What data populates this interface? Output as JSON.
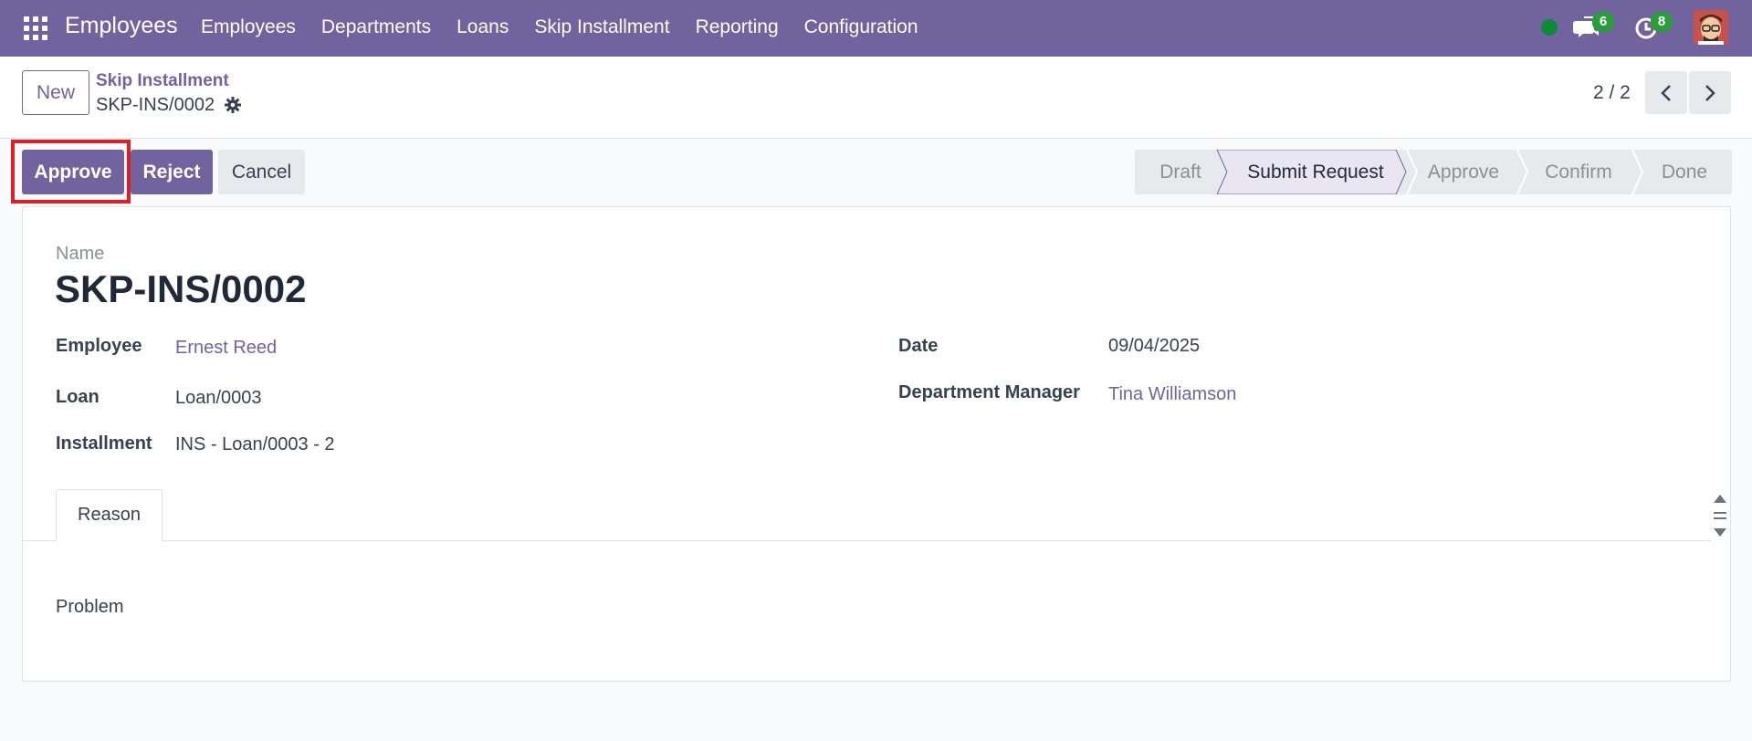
{
  "navbar": {
    "app_title": "Employees",
    "menu": [
      "Employees",
      "Departments",
      "Loans",
      "Skip Installment",
      "Reporting",
      "Configuration"
    ],
    "messages_count": "6",
    "activities_count": "8",
    "background_color": "#71639e"
  },
  "control_panel": {
    "new_label": "New",
    "breadcrumb_parent": "Skip Installment",
    "breadcrumb_current": "SKP-INS/0002",
    "pager": "2 / 2"
  },
  "actions": {
    "approve_label": "Approve",
    "reject_label": "Reject",
    "cancel_label": "Cancel"
  },
  "statusbar": {
    "stages": [
      "Draft",
      "Submit Request",
      "Approve",
      "Confirm",
      "Done"
    ],
    "active": "Submit Request"
  },
  "form": {
    "name_label": "Name",
    "name_value": "SKP-INS/0002",
    "employee_label": "Employee",
    "employee_value": "Ernest Reed",
    "loan_label": "Loan",
    "loan_value": "Loan/0003",
    "installment_label": "Installment",
    "installment_value": "INS - Loan/0003 - 2",
    "date_label": "Date",
    "date_value": "09/04/2025",
    "manager_label": "Department Manager",
    "manager_value": "Tina Williamson"
  },
  "notebook": {
    "tab_reason": "Reason",
    "reason_text": "Problem"
  },
  "icons": [
    "apps-grid-icon",
    "presence-dot-icon",
    "chat-icon",
    "clock-icon",
    "gear-icon",
    "chevron-left-icon",
    "chevron-right-icon"
  ],
  "colors": {
    "primary": "#71639e",
    "badge": "#2a9d3b",
    "highlight": "#e41c24"
  }
}
